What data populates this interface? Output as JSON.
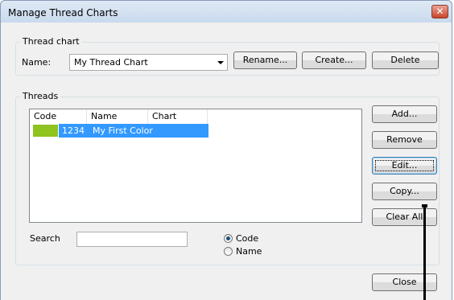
{
  "window": {
    "title": "Manage Thread Charts",
    "close_glyph": "✕"
  },
  "thread_chart_group": {
    "label": "Thread chart",
    "name_label": "Name:",
    "selected_chart": "My Thread Chart",
    "buttons": {
      "rename": "Rename...",
      "create": "Create...",
      "delete": "Delete"
    }
  },
  "threads_group": {
    "label": "Threads",
    "columns": [
      "Code",
      "Name",
      "Chart"
    ],
    "rows": [
      {
        "color": "#8fc31f",
        "code": "1234",
        "name": "My First Color",
        "chart": ""
      }
    ],
    "buttons": {
      "add": "Add...",
      "remove": "Remove",
      "edit": "Edit...",
      "copy": "Copy...",
      "clear_all": "Clear All"
    },
    "search_label": "Search",
    "search_value": "",
    "search_by": {
      "options": [
        "Code",
        "Name"
      ],
      "selected": "Code"
    }
  },
  "footer": {
    "close": "Close"
  },
  "colors": {
    "selection": "#3399ff",
    "swatch": "#8fc31f"
  }
}
